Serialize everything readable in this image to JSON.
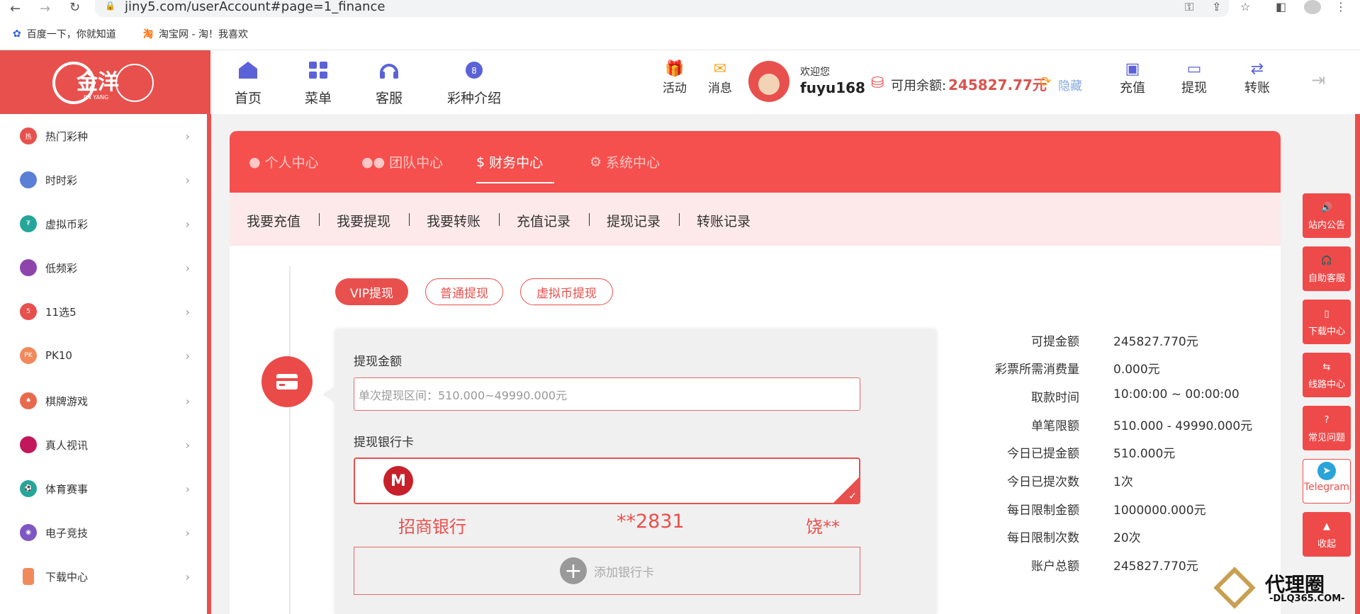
{
  "browser": {
    "url": "jiny5.com/userAccount#page=1_finance"
  },
  "bookmarks": [
    {
      "label": "百度一下，你就知道"
    },
    {
      "label": "淘宝网 - 淘！我喜欢"
    }
  ],
  "logo": {
    "text": "金洋",
    "sub": "JIN YANG"
  },
  "topnav": {
    "items": [
      {
        "label": "首页",
        "icon": "home-icon"
      },
      {
        "label": "菜单",
        "icon": "menu-grid-icon"
      },
      {
        "label": "客服",
        "icon": "headset-icon"
      },
      {
        "label": "彩种介绍",
        "icon": "lottery-ball-icon"
      }
    ],
    "activity_label": "活动",
    "message_label": "消息",
    "welcome": "欢迎您",
    "username": "fuyu168",
    "balance_label": "可用余额:",
    "balance_value": "245827.77元",
    "hide_label": "隐藏",
    "recharge_label": "充值",
    "withdraw_label": "提现",
    "transfer_label": "转账"
  },
  "sidebar": {
    "items": [
      {
        "label": "热门彩种",
        "color": "#e8504d"
      },
      {
        "label": "时时彩",
        "color": "#5b7fd6"
      },
      {
        "label": "虚拟币彩",
        "color": "#26a69a"
      },
      {
        "label": "低频彩",
        "color": "#8e44ad"
      },
      {
        "label": "11选5",
        "color": "#e8504d"
      },
      {
        "label": "PK10",
        "color": "#f08a5d"
      },
      {
        "label": "棋牌游戏",
        "color": "#e86a4d"
      },
      {
        "label": "真人视讯",
        "color": "#c2185b"
      },
      {
        "label": "体育赛事",
        "color": "#26a69a"
      },
      {
        "label": "电子竞技",
        "color": "#7e57c2"
      },
      {
        "label": "下载中心",
        "color": "#f08a5d"
      }
    ]
  },
  "tabs": [
    {
      "label": "个人中心",
      "icon": "user-icon"
    },
    {
      "label": "团队中心",
      "icon": "team-icon"
    },
    {
      "label": "财务中心",
      "icon": "finance-icon"
    },
    {
      "label": "系统中心",
      "icon": "settings-icon"
    }
  ],
  "subnav": [
    "我要充值",
    "我要提现",
    "我要转账",
    "充值记录",
    "提现记录",
    "转账记录"
  ],
  "withdraw_types": [
    "VIP提现",
    "普通提现",
    "虚拟币提现"
  ],
  "form": {
    "amount_label": "提现金额",
    "amount_placeholder": "单次提现区间：510.000~49990.000元",
    "card_label": "提现银行卡",
    "bank_name": "招商银行",
    "card_tail": "**2831",
    "card_holder": "饶**",
    "add_card_label": "添加银行卡"
  },
  "info": [
    {
      "key": "可提金额",
      "value": "245827.770元"
    },
    {
      "key": "彩票所需消费量",
      "value": "0.000元"
    },
    {
      "key": "取款时间",
      "value": "10:00:00 ~ 00:00:00"
    },
    {
      "key": "单笔限额",
      "value": "510.000 - 49990.000元"
    },
    {
      "key": "今日已提金额",
      "value": "510.000元"
    },
    {
      "key": "今日已提次数",
      "value": "1次"
    },
    {
      "key": "每日限制金额",
      "value": "1000000.000元"
    },
    {
      "key": "每日限制次数",
      "value": "20次"
    },
    {
      "key": "账户总额",
      "value": "245827.770元"
    }
  ],
  "float_buttons": [
    {
      "label": "站内公告",
      "icon": "speaker-icon"
    },
    {
      "label": "自助客服",
      "icon": "headset-icon"
    },
    {
      "label": "下载中心",
      "icon": "phone-icon"
    },
    {
      "label": "线路中心",
      "icon": "switch-icon"
    },
    {
      "label": "常见问题",
      "icon": "question-icon"
    },
    {
      "label": "Telegram",
      "icon": "telegram-icon"
    },
    {
      "label": "收起",
      "icon": "arrow-up-icon"
    }
  ],
  "watermark": {
    "brand": "代理圈",
    "site": "-DLQ365.COM-"
  },
  "colors": {
    "accent": "#e8504d",
    "panel": "#f5504e",
    "subnav_bg": "#fde9e9",
    "balance": "#d9534f"
  }
}
